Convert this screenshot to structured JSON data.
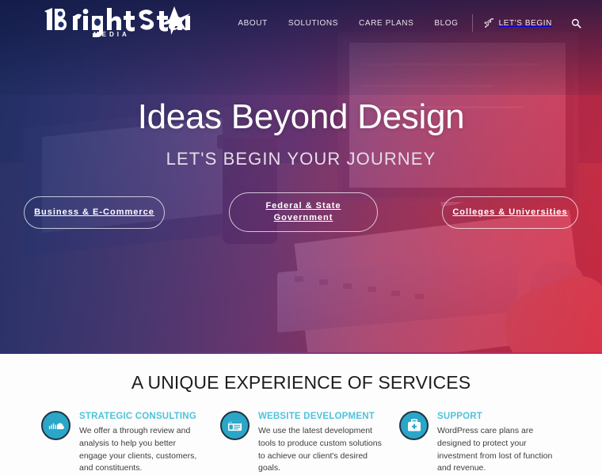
{
  "brand": {
    "logo_text": "1BrightStar",
    "logo_sub": "MEDIA"
  },
  "nav": {
    "items": [
      {
        "label": "ABOUT",
        "icon": ""
      },
      {
        "label": "SOLUTIONS",
        "icon": ""
      },
      {
        "label": "CARE PLANS",
        "icon": ""
      },
      {
        "label": "BLOG",
        "icon": ""
      }
    ],
    "cta": {
      "label": "LET'S BEGIN",
      "icon": "rocket-icon"
    },
    "search_icon": "search-icon"
  },
  "hero": {
    "title": "Ideas Beyond Design",
    "subtitle": "LET'S BEGIN YOUR JOURNEY",
    "pills": [
      {
        "label": "Business & E-Commerce"
      },
      {
        "label": "Federal & State\nGovernment"
      },
      {
        "label": "Colleges & Universities"
      }
    ]
  },
  "services": {
    "heading": "A UNIQUE EXPERIENCE OF SERVICES",
    "cards": [
      {
        "icon": "soundwave-cloud-icon",
        "title": "STRATEGIC CONSULTING",
        "text": "We offer a through review and analysis to help you better engage your clients, customers, and constituents."
      },
      {
        "icon": "browser-window-icon",
        "title": "WEBSITE DEVELOPMENT",
        "text": "We use the latest development tools to produce custom solutions to achieve our client's desired goals."
      },
      {
        "icon": "first-aid-kit-icon",
        "title": "SUPPORT",
        "text": "WordPress care plans are designed to protect your investment from lost of function and revenue."
      }
    ]
  },
  "colors": {
    "accent_teal": "#4ec3dd",
    "icon_circle": "#2aa6c8",
    "hero_gradient_start": "#202d64",
    "hero_gradient_end": "#de223e",
    "text_dark": "#1d1d1d"
  }
}
